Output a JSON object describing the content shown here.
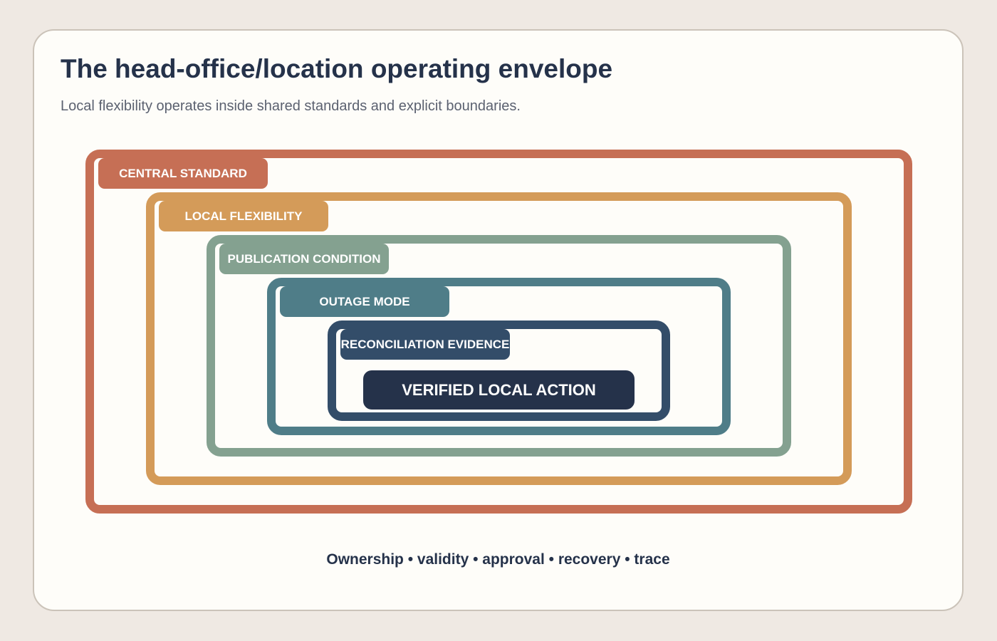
{
  "header": {
    "title": "The head-office/location operating envelope",
    "subtitle": "Local flexibility operates inside shared standards and explicit boundaries."
  },
  "layers": [
    {
      "label": "CENTRAL STANDARD",
      "color": "#c66f55"
    },
    {
      "label": "LOCAL FLEXIBILITY",
      "color": "#d49b59"
    },
    {
      "label": "PUBLICATION CONDITION",
      "color": "#84a190"
    },
    {
      "label": "OUTAGE MODE",
      "color": "#4f7d88"
    },
    {
      "label": "RECONCILIATION EVIDENCE",
      "color": "#334d69"
    }
  ],
  "core": {
    "label": "VERIFIED LOCAL ACTION",
    "color": "#25324a"
  },
  "footer": {
    "text": "Ownership • validity • approval • recovery • trace"
  }
}
